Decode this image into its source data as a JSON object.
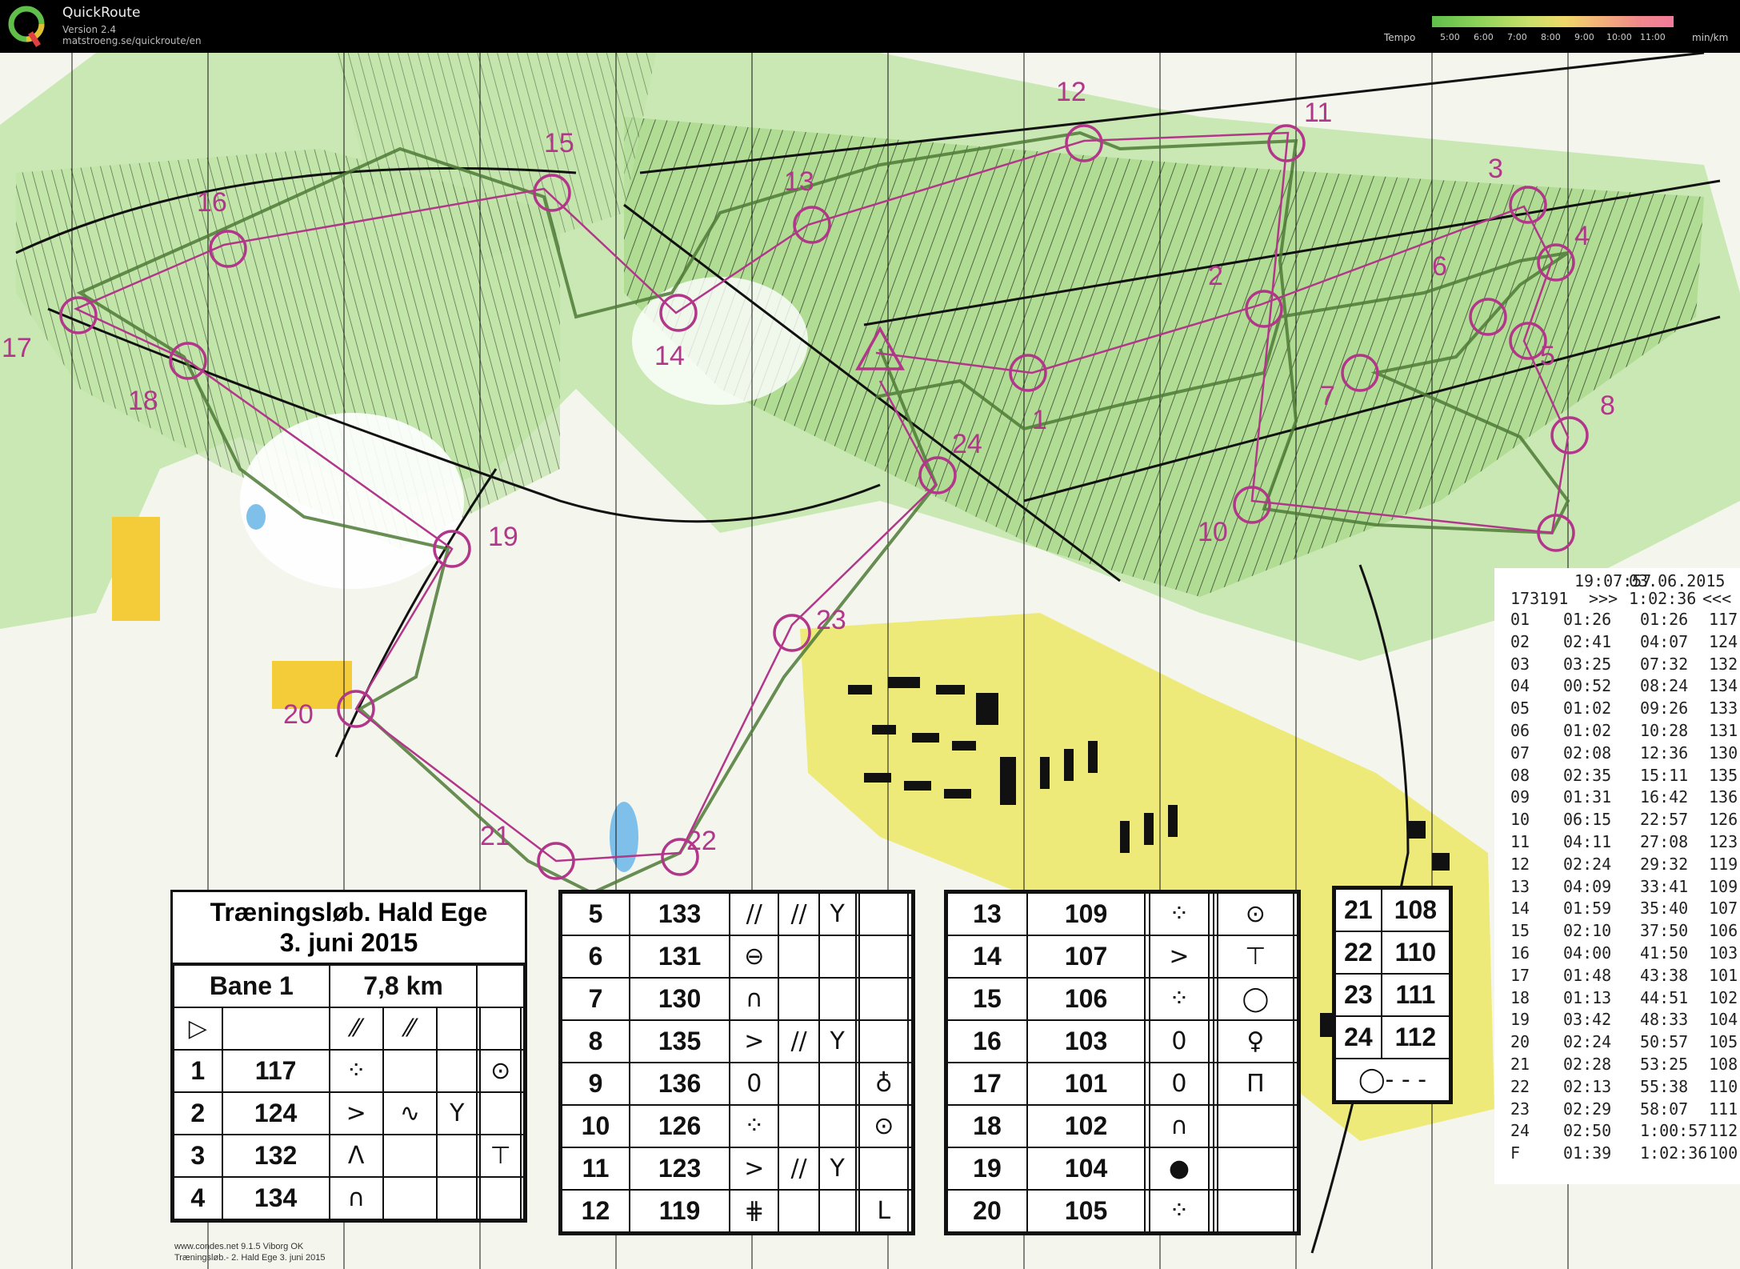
{
  "app": {
    "name": "QuickRoute",
    "version": "Version 2.4",
    "url": "matstroeng.se/quickroute/en"
  },
  "tempo": {
    "label": "Tempo",
    "unit": "min/km",
    "ticks": [
      "5:00",
      "6:00",
      "7:00",
      "8:00",
      "9:00",
      "10:00",
      "11:00"
    ]
  },
  "controls": [
    "1",
    "2",
    "3",
    "4",
    "5",
    "6",
    "7",
    "8",
    "10",
    "11",
    "12",
    "13",
    "14",
    "15",
    "16",
    "17",
    "18",
    "19",
    "20",
    "21",
    "22",
    "23",
    "24"
  ],
  "descriptions": {
    "title_line1": "Træningsløb. Hald Ege",
    "title_line2": "3. juni 2015",
    "course": "Bane 1",
    "length": "7,8 km",
    "start_symbol": "▷",
    "finish_symbol": "◯- - -",
    "rows": [
      {
        "n": "1",
        "code": "117",
        "c": "⁘",
        "g": "⊙"
      },
      {
        "n": "2",
        "code": "124",
        "c": ">",
        "d": "∿",
        "e": "Y"
      },
      {
        "n": "3",
        "code": "132",
        "c": "Λ",
        "g": "⊤"
      },
      {
        "n": "4",
        "code": "134",
        "c": "∩"
      },
      {
        "n": "5",
        "code": "133",
        "c": "//",
        "d": "//",
        "e": "Y"
      },
      {
        "n": "6",
        "code": "131",
        "c": "⊖"
      },
      {
        "n": "7",
        "code": "130",
        "c": "∩"
      },
      {
        "n": "8",
        "code": "135",
        "c": ">",
        "d": "//",
        "e": "Y"
      },
      {
        "n": "9",
        "code": "136",
        "c": "0",
        "g": "♁"
      },
      {
        "n": "10",
        "code": "126",
        "c": "⁘",
        "g": "⊙"
      },
      {
        "n": "11",
        "code": "123",
        "c": ">",
        "d": "//",
        "e": "Y"
      },
      {
        "n": "12",
        "code": "119",
        "c": "⋕",
        "g": "L"
      },
      {
        "n": "13",
        "code": "109",
        "c": "⁘",
        "g": "⊙"
      },
      {
        "n": "14",
        "code": "107",
        "c": ">",
        "g": "⊤"
      },
      {
        "n": "15",
        "code": "106",
        "c": "⁘",
        "g": "◯"
      },
      {
        "n": "16",
        "code": "103",
        "c": "0",
        "g": "♀"
      },
      {
        "n": "17",
        "code": "101",
        "c": "0",
        "g": "Π"
      },
      {
        "n": "18",
        "code": "102",
        "c": "∩"
      },
      {
        "n": "19",
        "code": "104",
        "c": "●"
      },
      {
        "n": "20",
        "code": "105",
        "c": "⁘"
      },
      {
        "n": "21",
        "code": "108"
      },
      {
        "n": "22",
        "code": "110"
      },
      {
        "n": "23",
        "code": "111"
      },
      {
        "n": "24",
        "code": "112"
      }
    ]
  },
  "splits": {
    "time": "19:07:57",
    "date": "03.06.2015",
    "card": "173191",
    "marker": ">>>",
    "total": "1:02:36",
    "end_marker": "<<<",
    "rows": [
      {
        "n": "01",
        "split": "01:26",
        "cum": "01:26",
        "code": "117"
      },
      {
        "n": "02",
        "split": "02:41",
        "cum": "04:07",
        "code": "124"
      },
      {
        "n": "03",
        "split": "03:25",
        "cum": "07:32",
        "code": "132"
      },
      {
        "n": "04",
        "split": "00:52",
        "cum": "08:24",
        "code": "134"
      },
      {
        "n": "05",
        "split": "01:02",
        "cum": "09:26",
        "code": "133"
      },
      {
        "n": "06",
        "split": "01:02",
        "cum": "10:28",
        "code": "131"
      },
      {
        "n": "07",
        "split": "02:08",
        "cum": "12:36",
        "code": "130"
      },
      {
        "n": "08",
        "split": "02:35",
        "cum": "15:11",
        "code": "135"
      },
      {
        "n": "09",
        "split": "01:31",
        "cum": "16:42",
        "code": "136"
      },
      {
        "n": "10",
        "split": "06:15",
        "cum": "22:57",
        "code": "126"
      },
      {
        "n": "11",
        "split": "04:11",
        "cum": "27:08",
        "code": "123"
      },
      {
        "n": "12",
        "split": "02:24",
        "cum": "29:32",
        "code": "119"
      },
      {
        "n": "13",
        "split": "04:09",
        "cum": "33:41",
        "code": "109"
      },
      {
        "n": "14",
        "split": "01:59",
        "cum": "35:40",
        "code": "107"
      },
      {
        "n": "15",
        "split": "02:10",
        "cum": "37:50",
        "code": "106"
      },
      {
        "n": "16",
        "split": "04:00",
        "cum": "41:50",
        "code": "103"
      },
      {
        "n": "17",
        "split": "01:48",
        "cum": "43:38",
        "code": "101"
      },
      {
        "n": "18",
        "split": "01:13",
        "cum": "44:51",
        "code": "102"
      },
      {
        "n": "19",
        "split": "03:42",
        "cum": "48:33",
        "code": "104"
      },
      {
        "n": "20",
        "split": "02:24",
        "cum": "50:57",
        "code": "105"
      },
      {
        "n": "21",
        "split": "02:28",
        "cum": "53:25",
        "code": "108"
      },
      {
        "n": "22",
        "split": "02:13",
        "cum": "55:38",
        "code": "110"
      },
      {
        "n": "23",
        "split": "02:29",
        "cum": "58:07",
        "code": "111"
      },
      {
        "n": "24",
        "split": "02:50",
        "cum": "1:00:57",
        "code": "112"
      },
      {
        "n": "F",
        "split": "01:39",
        "cum": "1:02:36",
        "code": "100"
      }
    ]
  },
  "footer": {
    "line1": "www.condes.net 9.1.5 Viborg OK",
    "line2": "Træningsløb.- 2. Hald Ege 3. juni 2015"
  }
}
